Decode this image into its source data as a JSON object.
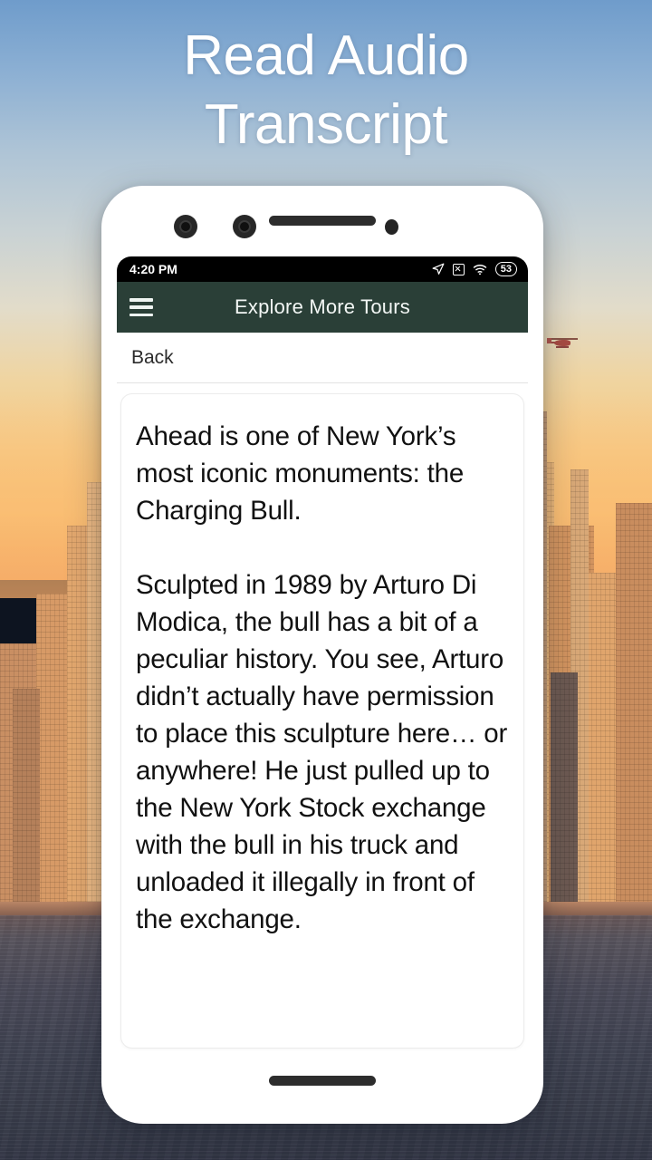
{
  "headline": {
    "line1": "Read Audio",
    "line2": "Transcript"
  },
  "background": {
    "scene": "new-york-skyline-sunset",
    "sky_top_color": "#6f9ccb",
    "sky_horizon_color": "#f6ad63",
    "water_color": "#414453",
    "helicopter": "helicopter-icon"
  },
  "phone": {
    "hardware": {
      "camera_left": "camera-lens-icon",
      "camera_right": "camera-lens-icon",
      "earpiece": "earpiece-speaker",
      "sensor": "proximity-sensor",
      "bottom_speaker": "bottom-speaker"
    },
    "status_bar": {
      "time": "4:20 PM",
      "battery_percent": "53",
      "icons": [
        "location-arrow-icon",
        "mute-icon",
        "wifi-icon",
        "battery-icon"
      ]
    },
    "app_bar": {
      "menu_icon": "hamburger-menu-icon",
      "title": "Explore More Tours",
      "background_color": "#2a3f37",
      "text_color": "#f2f6f4"
    },
    "back_row": {
      "label": "Back"
    },
    "transcript": {
      "paragraphs": [
        "Ahead is one of New York’s most iconic monuments: the Charging Bull.",
        "Sculpted in 1989 by Arturo Di Modica, the bull has a bit of a peculiar history. You see, Arturo didn’t actually have permission to place this sculpture here… or anywhere! He just pulled up to the New York Stock exchange with the bull in his truck and unloaded it illegally in front of the exchange."
      ]
    }
  }
}
